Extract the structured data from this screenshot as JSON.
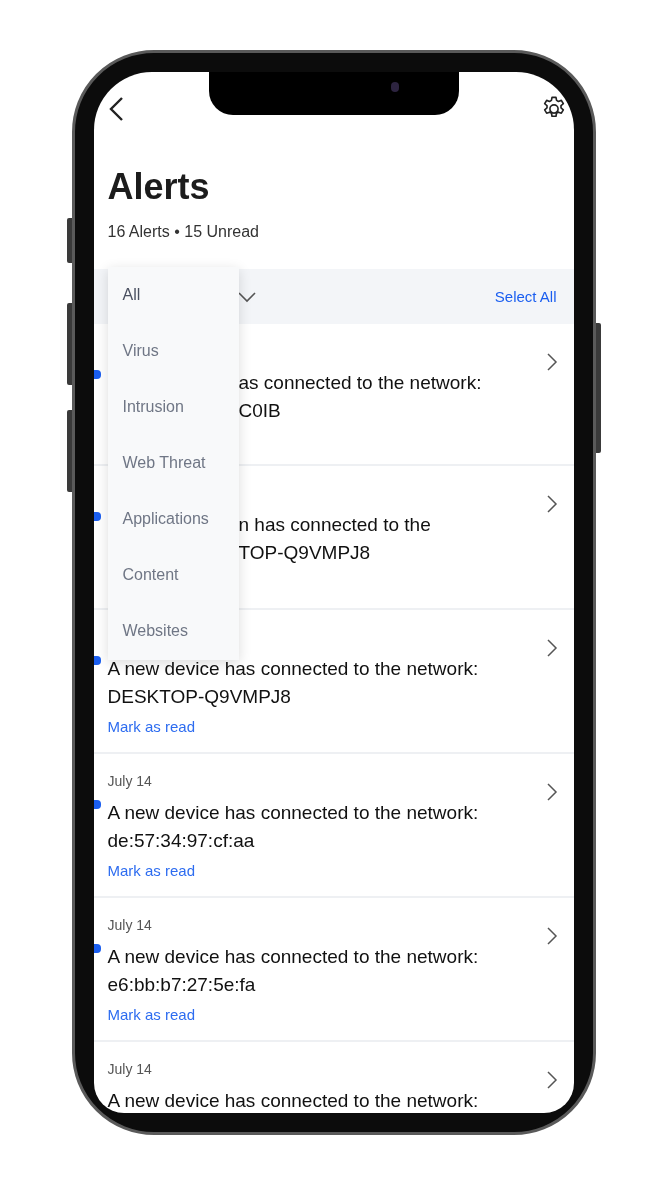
{
  "header": {
    "title": "Alerts",
    "summary": "16 Alerts • 15 Unread"
  },
  "filter_bar": {
    "select_all": "Select All"
  },
  "filter_menu": [
    {
      "label": "All",
      "selected": true
    },
    {
      "label": "Virus",
      "selected": false
    },
    {
      "label": "Intrusion",
      "selected": false
    },
    {
      "label": "Web Threat",
      "selected": false
    },
    {
      "label": "Applications",
      "selected": false
    },
    {
      "label": "Content",
      "selected": false
    },
    {
      "label": "Websites",
      "selected": false
    }
  ],
  "alerts": [
    {
      "kind": "covered",
      "unread": true,
      "lines": [
        "as connected to the network:",
        "C0IB"
      ]
    },
    {
      "kind": "covered",
      "unread": true,
      "lines": [
        "n has connected to the",
        "TOP-Q9VMPJ8"
      ]
    },
    {
      "kind": "full",
      "unread": true,
      "lines": [
        "A new device has connected to the network:",
        "DESKTOP-Q9VMPJ8"
      ],
      "action": "Mark as read"
    },
    {
      "kind": "full",
      "unread": true,
      "date": "July 14",
      "lines": [
        "A new device has connected to the network:",
        "de:57:34:97:cf:aa"
      ],
      "action": "Mark as read"
    },
    {
      "kind": "full",
      "unread": true,
      "date": "July 14",
      "lines": [
        "A new device has connected to the network:",
        "e6:bb:b7:27:5e:fa"
      ],
      "action": "Mark as read"
    },
    {
      "kind": "full",
      "unread": false,
      "date": "July 14",
      "lines": [
        "A new device has connected to the network:"
      ]
    }
  ]
}
